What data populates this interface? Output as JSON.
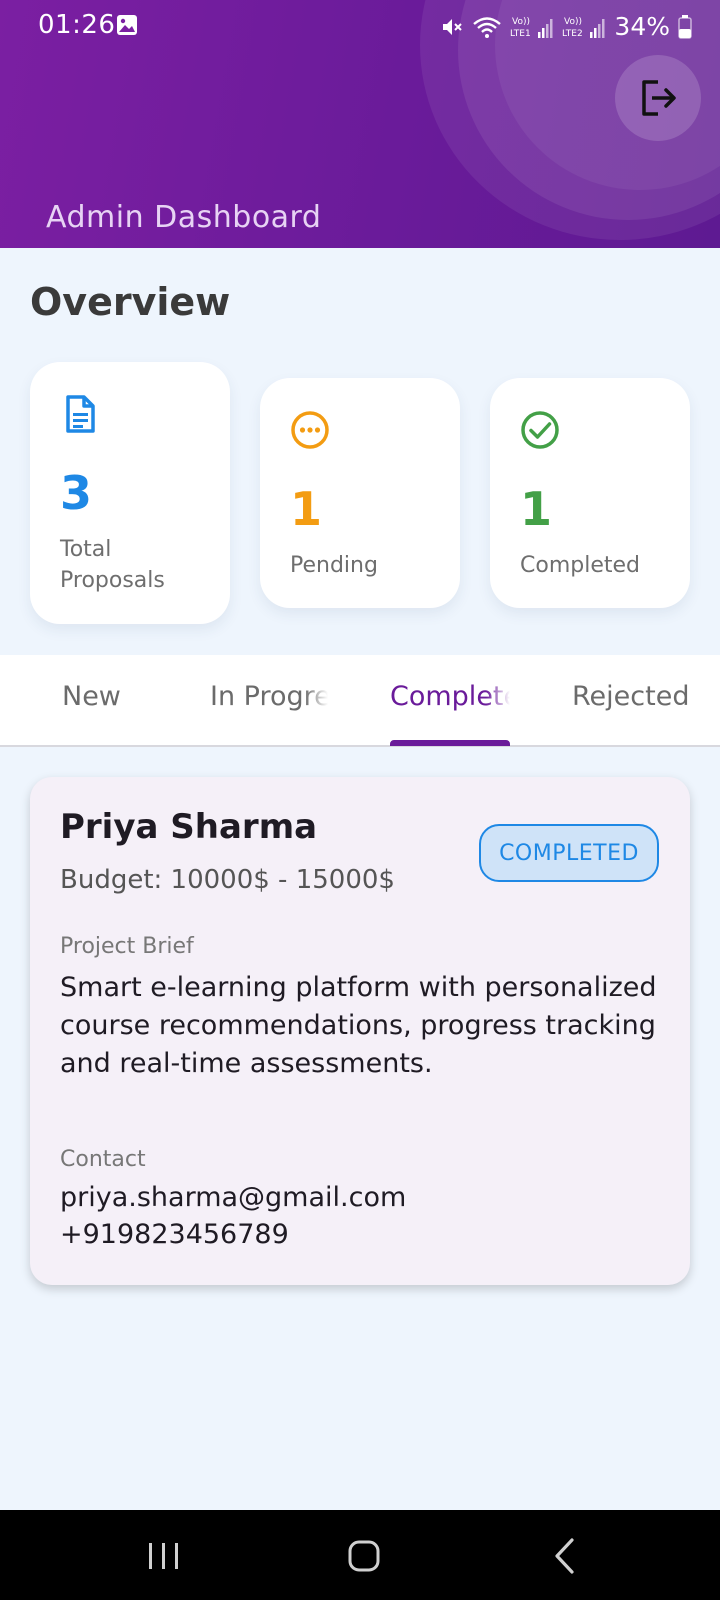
{
  "status_bar": {
    "time": "01:26",
    "battery": "34%"
  },
  "header": {
    "title": "Admin Dashboard",
    "accent_color": "#6a1b9a"
  },
  "overview": {
    "title": "Overview",
    "stats": [
      {
        "value": "3",
        "label": "Total Proposals",
        "icon": "document-icon",
        "color": "#1e88e5"
      },
      {
        "value": "1",
        "label": "Pending",
        "icon": "more-circle-icon",
        "color": "#f39c12"
      },
      {
        "value": "1",
        "label": "Completed",
        "icon": "check-circle-icon",
        "color": "#43a047"
      }
    ]
  },
  "tabs": [
    {
      "label": "New"
    },
    {
      "label": "In Progress"
    },
    {
      "label": "Completed",
      "selected": true
    },
    {
      "label": "Rejected"
    }
  ],
  "proposal": {
    "client_name": "Priya Sharma",
    "budget": "Budget: 10000$ - 15000$",
    "status": "COMPLETED",
    "brief_label": "Project Brief",
    "brief": "Smart e-learning platform with personalized course recommendations, progress tracking and real-time assessments.",
    "contact_label": "Contact",
    "email": "priya.sharma@gmail.com",
    "phone": "+919823456789"
  }
}
